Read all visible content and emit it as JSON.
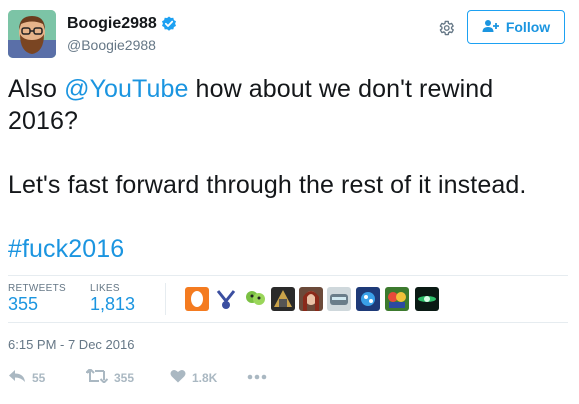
{
  "user": {
    "display_name": "Boogie2988",
    "handle": "@Boogie2988"
  },
  "header": {
    "follow_label": "Follow"
  },
  "tweet": {
    "line1_prefix": "Also ",
    "mention": "@YouTube",
    "line1_suffix": " how about we don't rewind 2016?",
    "line2": "Let's fast forward through the rest of it instead.",
    "hashtag": "#fuck2016"
  },
  "stats": {
    "retweets_label": "RETWEETS",
    "retweets_value": "355",
    "likes_label": "LIKES",
    "likes_value": "1,813"
  },
  "timestamp": "6:15 PM - 7 Dec 2016",
  "actions": {
    "reply_count": "55",
    "retweet_count": "355",
    "like_count": "1.8K"
  },
  "colors": {
    "link": "#1b95e0",
    "muted": "#657786",
    "action": "#aab8c2"
  }
}
